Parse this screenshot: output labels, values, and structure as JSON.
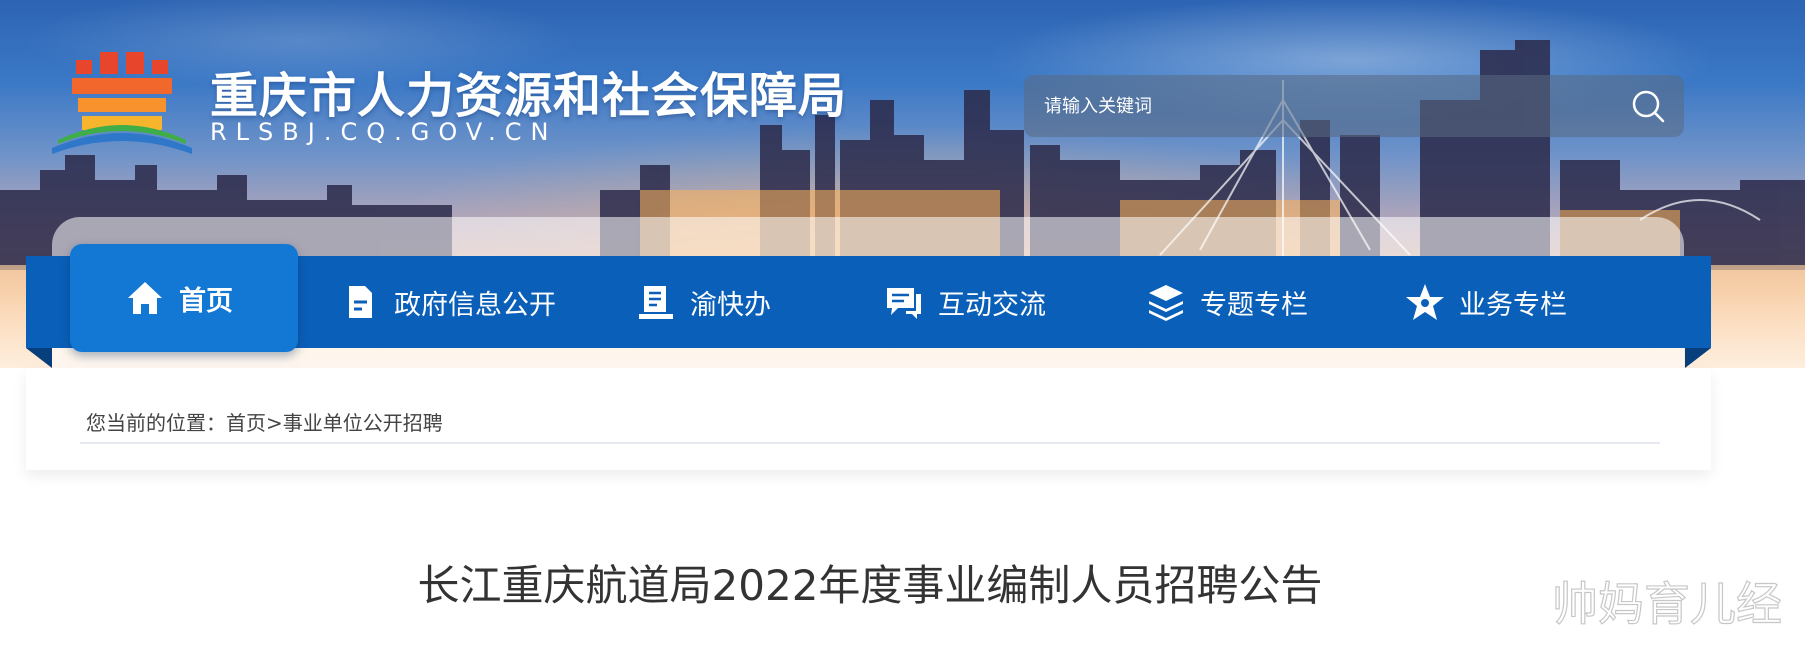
{
  "site": {
    "name": "重庆市人力资源和社会保障局",
    "domain": "RLSBJ.CQ.GOV.CN"
  },
  "search": {
    "placeholder": "请输入关键词",
    "icon": "search-icon"
  },
  "nav": {
    "items": [
      {
        "label": "首页",
        "icon": "home-icon",
        "active": true
      },
      {
        "label": "政府信息公开",
        "icon": "document-icon"
      },
      {
        "label": "渝快办",
        "icon": "clipboard-icon"
      },
      {
        "label": "互动交流",
        "icon": "chat-icon"
      },
      {
        "label": "专题专栏",
        "icon": "layers-icon"
      },
      {
        "label": "业务专栏",
        "icon": "star-icon"
      }
    ]
  },
  "breadcrumb": {
    "prefix": "您当前的位置：",
    "home": "首页",
    "separator": ">",
    "current": "事业单位公开招聘"
  },
  "article": {
    "title": "长江重庆航道局2022年度事业编制人员招聘公告"
  },
  "watermark": "帅妈育儿经",
  "colors": {
    "nav_bg": "#0a5fb8",
    "nav_active": "#1377d4",
    "title_text": "#333333"
  }
}
